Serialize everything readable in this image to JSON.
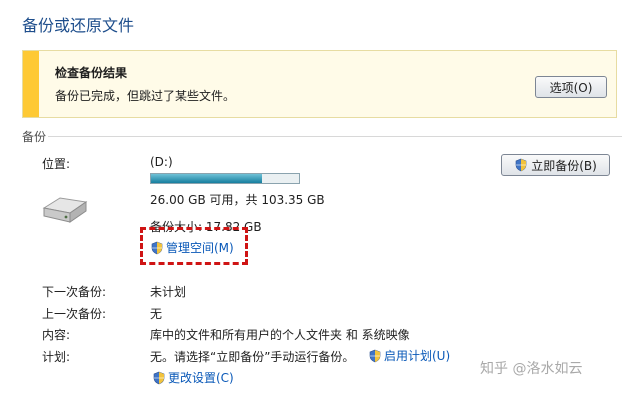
{
  "page": {
    "title": "备份或还原文件"
  },
  "banner": {
    "title": "检查备份结果",
    "message": "备份已完成，但跳过了某些文件。",
    "options_button": "选项(O)"
  },
  "backup": {
    "section_label": "备份",
    "location_label": "位置:",
    "location_value": "(D:)",
    "space_info": "26.00 GB 可用，共 103.35 GB",
    "usage_fraction": 0.75,
    "backup_size": "备份大小: 17.82 GB",
    "manage_space_link": "管理空间(M)",
    "backup_now_button": "立即备份(B)",
    "next_backup_label": "下一次备份:",
    "next_backup_value": "未计划",
    "last_backup_label": "上一次备份:",
    "last_backup_value": "无",
    "contents_label": "内容:",
    "contents_value": "库中的文件和所有用户的个人文件夹 和 系统映像",
    "schedule_label": "计划:",
    "schedule_value": "无。请选择“立即备份”手动运行备份。",
    "enable_schedule_link": "启用计划(U)",
    "change_settings_link": "更改设置(C)"
  },
  "watermark": "知乎 @洛水如云",
  "icons": [
    "drive-icon",
    "shield-icon"
  ],
  "colors": {
    "link": "#0a59b8",
    "warning": "#fec934",
    "highlight_box": "#cf1414"
  }
}
